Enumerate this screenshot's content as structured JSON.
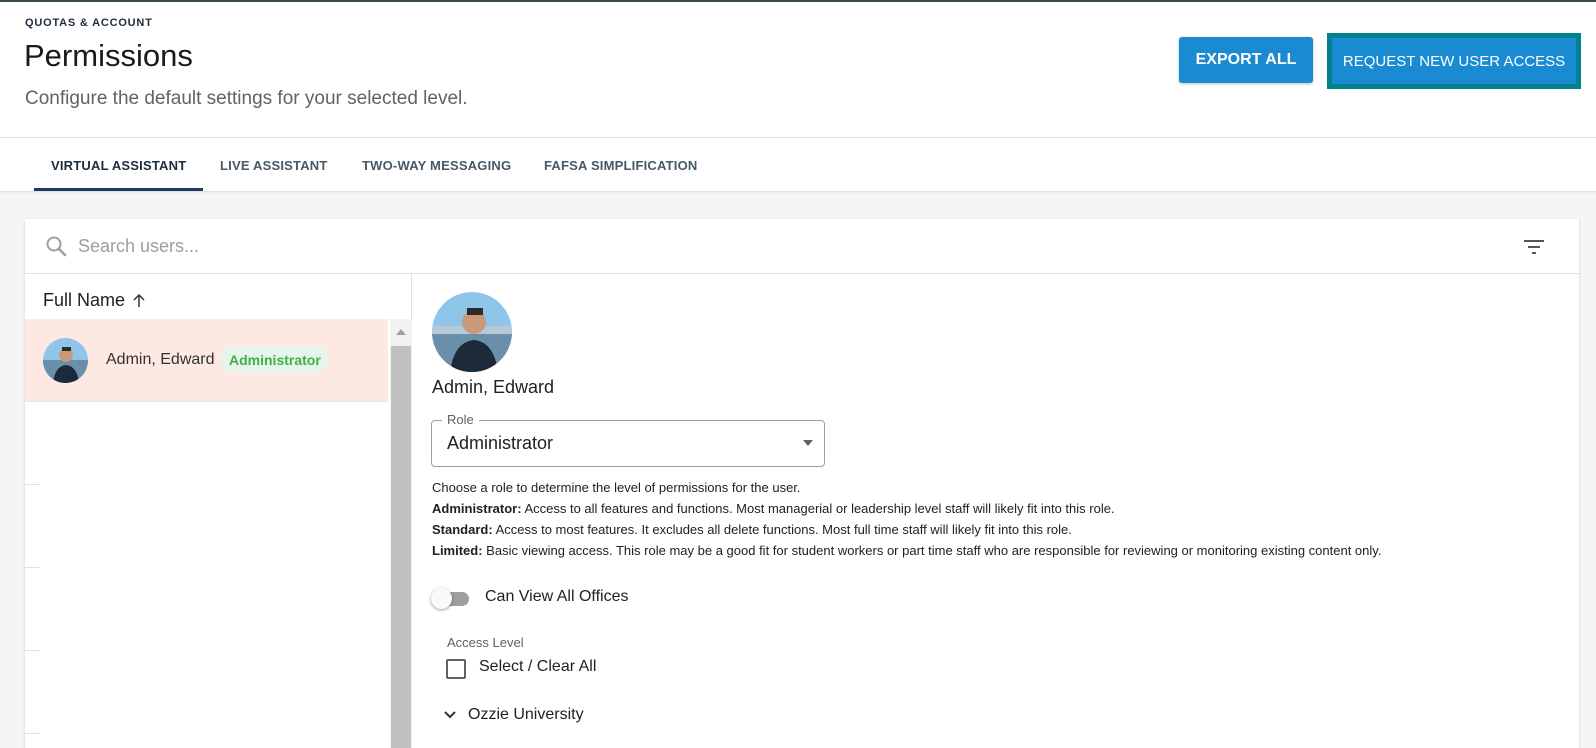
{
  "header": {
    "eyebrow": "QUOTAS & ACCOUNT",
    "title": "Permissions",
    "subtitle": "Configure the default settings for your selected level.",
    "export_label": "EXPORT ALL",
    "request_label": "REQUEST NEW USER ACCESS"
  },
  "tabs": [
    {
      "label": "VIRTUAL ASSISTANT",
      "active": true
    },
    {
      "label": "LIVE ASSISTANT",
      "active": false
    },
    {
      "label": "TWO-WAY MESSAGING",
      "active": false
    },
    {
      "label": "FAFSA SIMPLIFICATION",
      "active": false
    }
  ],
  "search": {
    "placeholder": "Search users...",
    "icon": "search-icon",
    "filter_icon": "filter-icon"
  },
  "user_list": {
    "column_header": "Full Name",
    "sort_icon": "arrow-up-icon",
    "users": [
      {
        "name": "Admin, Edward",
        "role": "Administrator",
        "selected": true
      }
    ]
  },
  "detail": {
    "name": "Admin, Edward",
    "role_field_label": "Role",
    "role_value": "Administrator",
    "help_intro": "Choose a role to determine the level of permissions for the user.",
    "roles_help": [
      {
        "term": "Administrator:",
        "text": " Access to all features and functions. Most managerial or leadership level staff will likely fit into this role."
      },
      {
        "term": "Standard:",
        "text": " Access to most features. It excludes all delete functions. Most full time staff will likely fit into this role."
      },
      {
        "term": "Limited:",
        "text": " Basic viewing access. This role may be a good fit for student workers or part time staff who are responsible for reviewing or monitoring existing content only."
      }
    ],
    "toggle_label": "Can View All Offices",
    "toggle_on": false,
    "access_level_label": "Access Level",
    "select_all_label": "Select / Clear All",
    "tree_item": "Ozzie University"
  },
  "colors": {
    "primary_button": "#1a8bd3",
    "focus_outline": "#00838f",
    "selected_row": "#fde8e2",
    "role_chip_text": "#3fb04a",
    "tab_active": "#1e3a5f"
  }
}
